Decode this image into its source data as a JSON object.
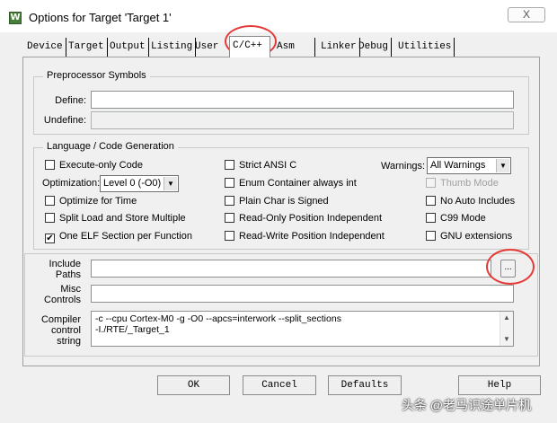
{
  "window": {
    "title": "Options for Target 'Target 1'",
    "app_icon_glyph": "W",
    "close_glyph": "X"
  },
  "tabs": [
    {
      "label": "Device",
      "active": false
    },
    {
      "label": "Target",
      "active": false
    },
    {
      "label": "Output",
      "active": false
    },
    {
      "label": "Listing",
      "active": false
    },
    {
      "label": "User",
      "active": false
    },
    {
      "label": "C/C++",
      "active": true
    },
    {
      "label": "Asm",
      "active": false
    },
    {
      "label": "Linker",
      "active": false
    },
    {
      "label": "Debug",
      "active": false
    },
    {
      "label": "Utilities",
      "active": false
    }
  ],
  "preprocessor": {
    "group_title": "Preprocessor Symbols",
    "define_label": "Define:",
    "define_value": "",
    "undefine_label": "Undefine:",
    "undefine_value": ""
  },
  "language": {
    "group_title": "Language / Code Generation",
    "execute_only": {
      "label": "Execute-only Code",
      "checked": false
    },
    "optimization_label": "Optimization:",
    "optimization_value": "Level 0 (-O0)",
    "optimize_time": {
      "label": "Optimize for Time",
      "checked": false
    },
    "split_load": {
      "label": "Split Load and Store Multiple",
      "checked": false
    },
    "one_elf": {
      "label": "One ELF Section per Function",
      "checked": true
    },
    "strict_ansi": {
      "label": "Strict ANSI C",
      "checked": false
    },
    "enum_container": {
      "label": "Enum Container always int",
      "checked": false
    },
    "plain_char": {
      "label": "Plain Char is Signed",
      "checked": false
    },
    "ropi": {
      "label": "Read-Only Position Independent",
      "checked": false
    },
    "rwpi": {
      "label": "Read-Write Position Independent",
      "checked": false
    },
    "warnings_label": "Warnings:",
    "warnings_value": "All Warnings",
    "thumb_mode": {
      "label": "Thumb Mode",
      "checked": false,
      "disabled": true
    },
    "no_auto_includes": {
      "label": "No Auto Includes",
      "checked": false
    },
    "c99_mode": {
      "label": "C99 Mode",
      "checked": false
    },
    "gnu_extensions": {
      "label": "GNU extensions",
      "checked": false
    }
  },
  "include_paths": {
    "label_line1": "Include",
    "label_line2": "Paths",
    "value": "",
    "browse_label": "..."
  },
  "misc_controls": {
    "label_line1": "Misc",
    "label_line2": "Controls",
    "value": ""
  },
  "compiler_control": {
    "label_line1": "Compiler",
    "label_line2": "control",
    "label_line3": "string",
    "line1": "-c --cpu Cortex-M0 -g -O0 --apcs=interwork --split_sections",
    "line2": "-I./RTE/_Target_1"
  },
  "buttons": {
    "ok": "OK",
    "cancel": "Cancel",
    "defaults": "Defaults",
    "help": "Help"
  },
  "checkmark_glyph": "✔",
  "dropdown_glyph": "▼",
  "scroll_up_glyph": "▲",
  "scroll_down_glyph": "▼",
  "watermark": "头条 @老马识途单片机",
  "annotation_color": "#e53935"
}
